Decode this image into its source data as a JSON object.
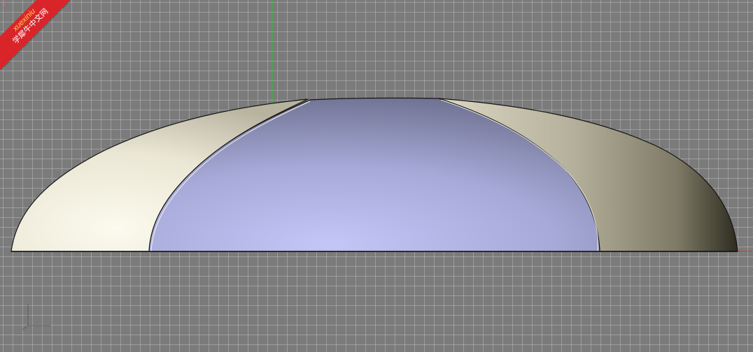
{
  "viewport": {
    "type": "3d-modeling-viewport",
    "grid": true,
    "background_color": "#7b7b7b",
    "grid_color": "#b9b9b9"
  },
  "axes": {
    "y_axis_color": "#2fbf2f",
    "x_axis_color": "#d23a3a"
  },
  "model": {
    "name": "dome-shell",
    "left_panel_color": "#e9e6d6",
    "center_panel_color": "#b8bbec",
    "right_panel_color": "#bdb9a6",
    "edge_color": "#141414"
  },
  "watermark": {
    "line1": "xuexiniu",
    "line2": "学犀牛中文网",
    "corner_text": "F"
  },
  "axis_gizmo": {
    "icon": "axis-gizmo-icon"
  }
}
